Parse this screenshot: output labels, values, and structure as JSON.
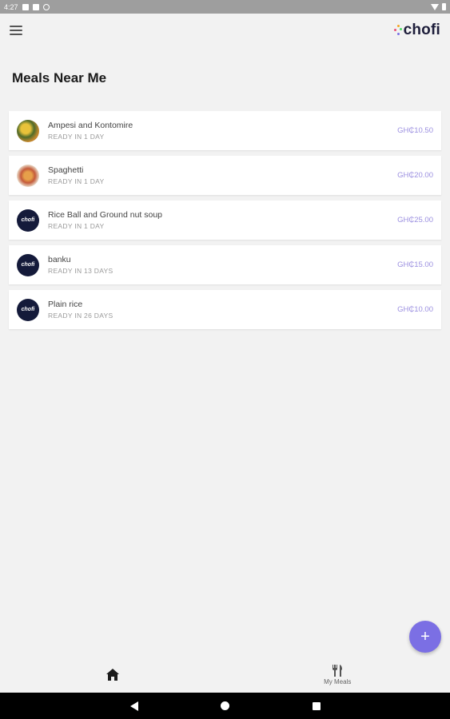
{
  "status_bar": {
    "time": "4:27"
  },
  "app": {
    "logo_text": "chofi"
  },
  "page": {
    "title": "Meals Near Me"
  },
  "meals": [
    {
      "name": "Ampesi and Kontomire",
      "ready": "READY IN 1 DAY",
      "price": "GH₵10.50",
      "avatar": "food-photo"
    },
    {
      "name": "Spaghetti",
      "ready": "READY IN 1 DAY",
      "price": "GH₵20.00",
      "avatar": "food-photo"
    },
    {
      "name": "Rice Ball and Ground nut soup",
      "ready": "READY IN 1 DAY",
      "price": "GH₵25.00",
      "avatar": "chofi-logo"
    },
    {
      "name": "banku",
      "ready": "READY IN 13 DAYS",
      "price": "GH₵15.00",
      "avatar": "chofi-logo"
    },
    {
      "name": "Plain rice",
      "ready": "READY IN 26 DAYS",
      "price": "GH₵10.00",
      "avatar": "chofi-logo"
    }
  ],
  "avatar_brand_text": "chofi",
  "fab": {
    "label": "+"
  },
  "bottom_nav": [
    {
      "label": "",
      "icon": "home-icon"
    },
    {
      "label": "My Meals",
      "icon": "utensils-icon"
    }
  ],
  "colors": {
    "accent": "#7b6fe4",
    "price": "#9b8fe0",
    "brand_dark": "#141a3a",
    "background": "#f2f2f2"
  }
}
